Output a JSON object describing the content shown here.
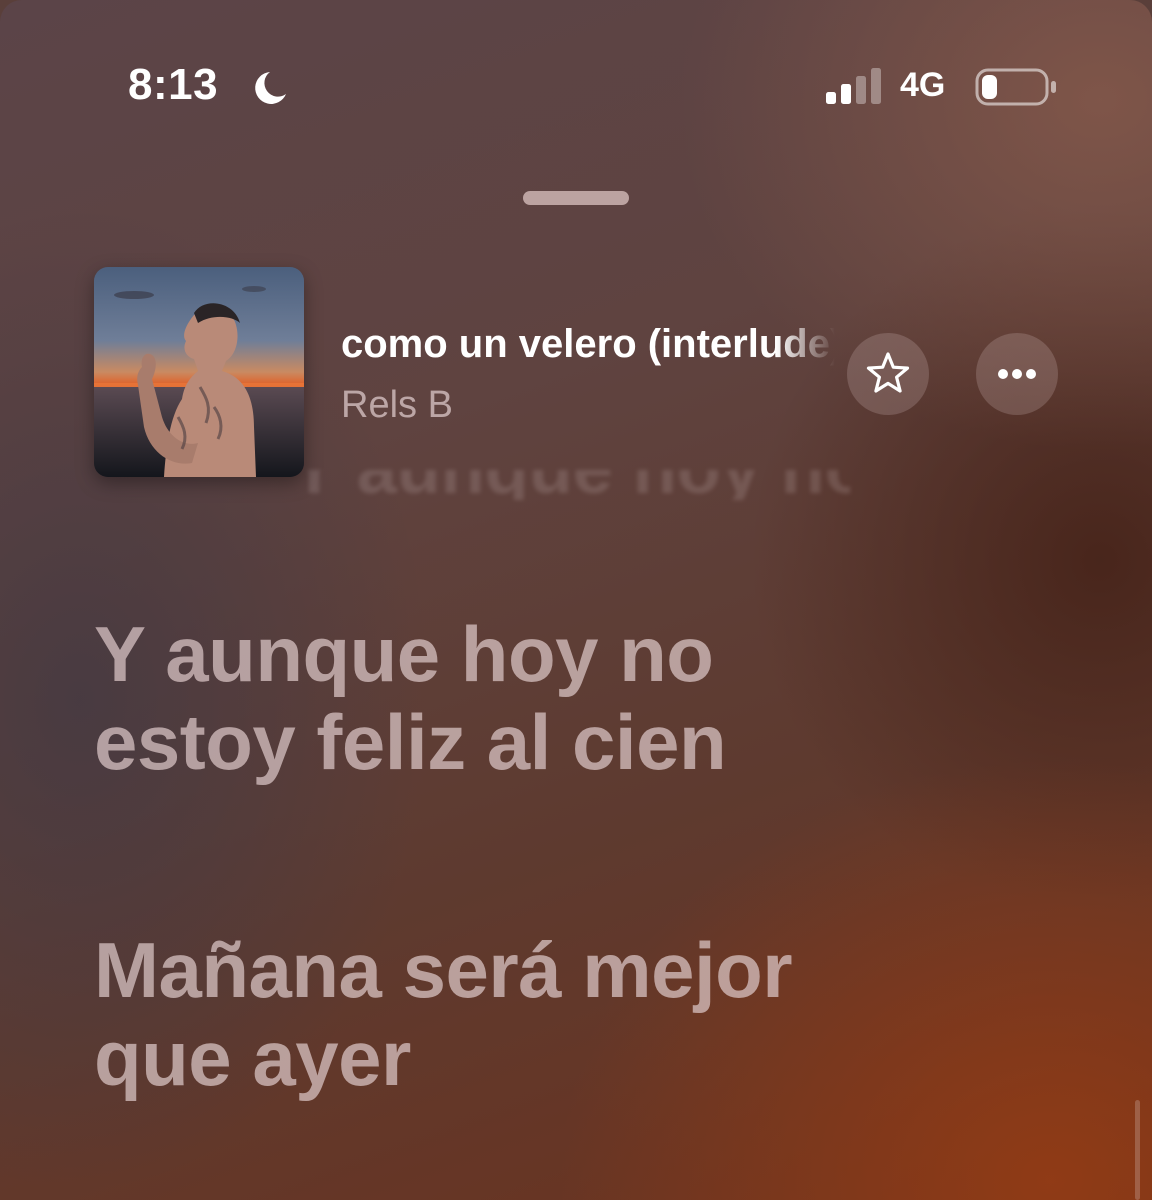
{
  "status_bar": {
    "time": "8:13",
    "focus_icon": "moon-icon",
    "signal_icon": "cellular-signal-icon",
    "signal_bars_active": 2,
    "signal_bars_total": 4,
    "network": "4G",
    "battery_icon": "battery-icon",
    "battery_level": 0.25
  },
  "now_playing": {
    "artwork_icon": "album-artwork",
    "title": "como un velero (interlude)",
    "artist": "Rels B",
    "favorite_icon": "star-icon",
    "more_icon": "ellipsis-icon"
  },
  "lyrics": [
    {
      "text": "Y aunque hoy no\nestoy feliz al cien"
    },
    {
      "text": "Mañana será mejor\nque ayer"
    }
  ],
  "colors": {
    "background_warm": "#6d321d",
    "background_cool": "#5b4448",
    "lyric_text": "#dcc8c8",
    "primary_text": "#ffffff"
  }
}
